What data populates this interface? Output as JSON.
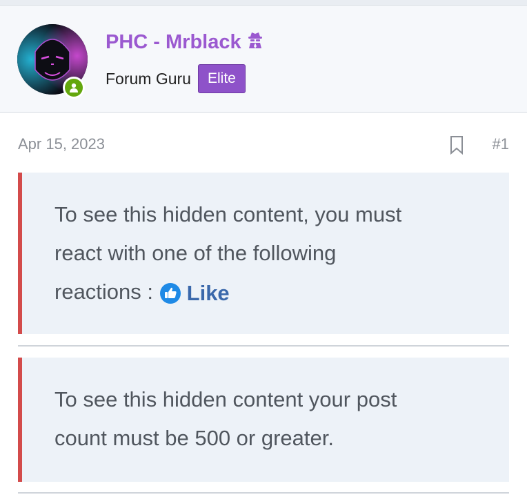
{
  "user": {
    "name": "PHC - Mrblack",
    "title": "Forum Guru",
    "badge": "Elite"
  },
  "post": {
    "date": "Apr 15, 2023",
    "number": "#1"
  },
  "hidden_blocks": [
    {
      "line1": "To see this hidden content, you must",
      "line2": "react with one of the following",
      "line3_prefix": "reactions :",
      "reaction_label": "Like"
    },
    {
      "line1": "To see this hidden content your post",
      "line2": "count must be 500 or greater."
    }
  ],
  "colors": {
    "username": "#9b59d0",
    "badge_bg": "#8e52c9",
    "online": "#63a70d",
    "box_bg": "#edf2f8",
    "box_border": "#d34b4b",
    "like": "#3a68ab"
  },
  "icons": {
    "username_icon": "spy-icon",
    "online": "user-online-icon",
    "bookmark": "bookmark-icon",
    "reaction": "thumbs-up-icon"
  }
}
